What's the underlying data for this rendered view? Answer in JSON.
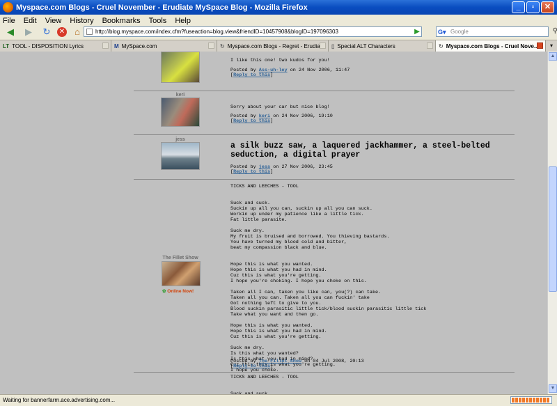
{
  "window": {
    "title": "Myspace.com Blogs - Cruel November - Erudiate MySpace Blog - Mozilla Firefox"
  },
  "menu": [
    "File",
    "Edit",
    "View",
    "History",
    "Bookmarks",
    "Tools",
    "Help"
  ],
  "nav": {
    "url": "http://blog.myspace.com/index.cfm?fuseaction=blog.view&friendID=10457908&blogID=197096303",
    "search_placeholder": "Google"
  },
  "tabs": [
    {
      "label": "TOOL - DISPOSITION Lyrics",
      "icon": "LT"
    },
    {
      "label": "MySpace.com",
      "icon": "M"
    },
    {
      "label": "Myspace.com Blogs - Regret - Erudiat...",
      "icon": "↻"
    },
    {
      "label": "Special ALT Characters",
      "icon": "▯"
    },
    {
      "label": "Myspace.com Blogs - Cruel Nove...",
      "icon": "↻",
      "active": true
    }
  ],
  "comments": [
    {
      "name": "",
      "body": "I like this one! two kudos for you!",
      "posted_prefix": "Posted by ",
      "user": "Ass-uh-ley",
      "posted_suffix": " on 24 Nov 2006, 11:47",
      "reply": "Reply to this"
    },
    {
      "name": "keri",
      "body": "Sorry about your car but nice blog!",
      "posted_prefix": "Posted by ",
      "user": "keri",
      "posted_suffix": " on 24 Nov 2006, 19:10",
      "reply": "Reply to this"
    },
    {
      "name": "jess",
      "body": "a silk buzz saw, a laquered jackhammer, a steel-belted seduction, a digital prayer",
      "posted_prefix": "Posted by ",
      "user": "jess",
      "posted_suffix": " on 27 Nov 2006, 23:45",
      "reply": "Reply to this"
    },
    {
      "name": "The Fillet Show",
      "online": "Online Now!",
      "body": "TICKS AND LEECHES - TOOL\n\n\nSuck and suck.\nSuckin up all you can, suckin up all you can suck.\nWorkin up under my patience like a little tick.\nFat little parasite.\n\nSuck me dry.\nMy fruit is bruised and borrowed. You thieving bastards.\nYou have turned my blood cold and bitter,\nbeat my compassion black and blue.\n\n\nHope this is what you wanted.\nHope this is what you had in mind.\nCuz this is what you're getting.\nI hope you're choking. I hope you choke on this.\n\nTaken all I can, taken you like can, you(?) can take.\nTaken all you can. Taken all you can fuckin' take\nGot nothing left to give to you.\nBlood suckin parasitic little tick/blood suckin parasitic little tick\nTake what you want and then go.\n\nHope this is what you wanted.\nHope this is what you had in mind.\nCuz this is what you're getting.\n\nSuck me dry.\nIs this what you wanted?\nIs this what you had in mind?\nCuz this this is what you're getting.\nI hope you choke.",
      "posted_prefix": "Posted by ",
      "user": "The Fillet Show",
      "posted_suffix": " on 04 Jul 2008, 20:13",
      "reply": "Reply to this"
    },
    {
      "body": "TICKS AND LEECHES - TOOL\n\n\nSuck and suck."
    }
  ],
  "status": "Waiting for bannerfarm.ace.advertising.com...",
  "colors": {
    "link": "#336699",
    "page_bg": "#c0c0c0",
    "online": "#d23c00"
  }
}
